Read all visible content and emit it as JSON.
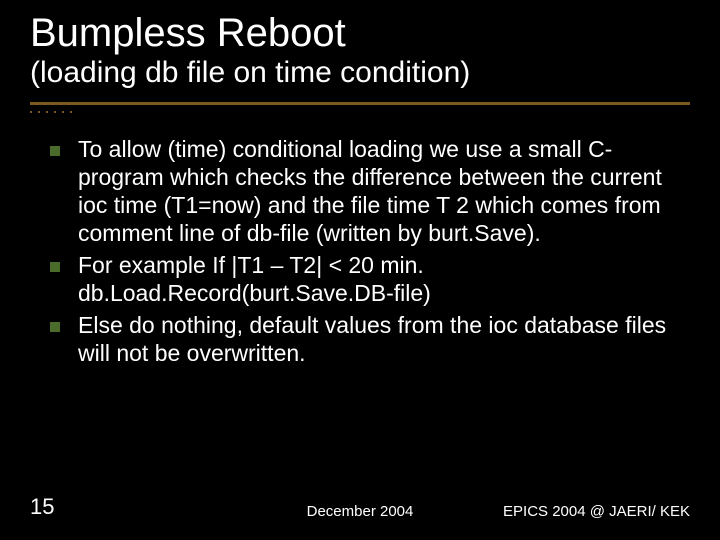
{
  "title": "Bumpless Reboot",
  "subtitle": "(loading db file on time condition)",
  "bullets": [
    "To allow (time) conditional loading we use a small C-program which checks the difference between the current ioc time (T1=now)  and the file time T 2 which comes from comment line of db-file (written by burt.Save).",
    "For example   If |T1 – T2| < 20 min. db.Load.Record(burt.Save.DB-file)",
    "Else do nothing, default values from the ioc database files will not be overwritten."
  ],
  "footer": {
    "page": "15",
    "center": "December 2004",
    "right": "EPICS 2004 @ JAERI/ KEK"
  }
}
